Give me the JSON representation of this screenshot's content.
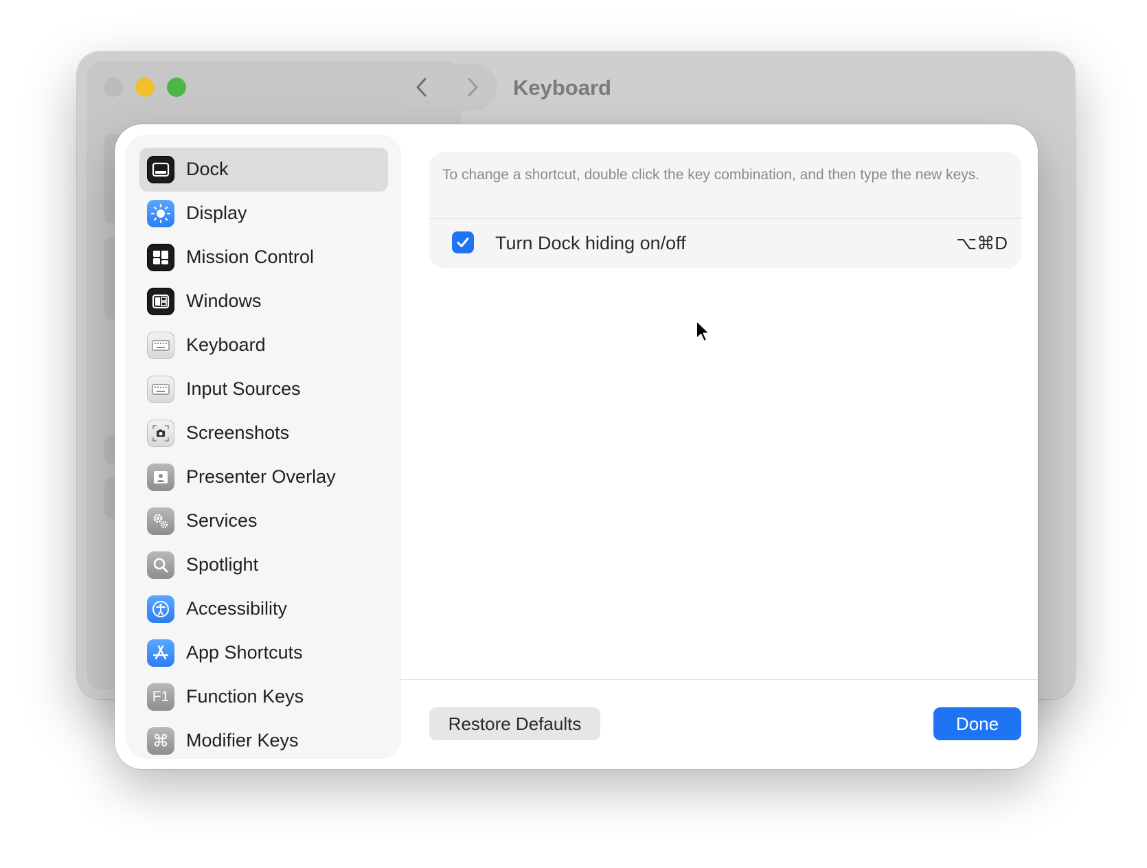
{
  "background_window": {
    "title": "Keyboard",
    "nav": {
      "back_icon": "chevron-left-icon",
      "forward_icon": "chevron-right-icon"
    }
  },
  "sidebar": {
    "items": [
      {
        "label": "Dock",
        "icon": "dock-icon",
        "selected": true
      },
      {
        "label": "Display",
        "icon": "display-brightness-icon"
      },
      {
        "label": "Mission Control",
        "icon": "mission-control-icon"
      },
      {
        "label": "Windows",
        "icon": "windows-icon"
      },
      {
        "label": "Keyboard",
        "icon": "keyboard-icon"
      },
      {
        "label": "Input Sources",
        "icon": "input-sources-keyboard-icon"
      },
      {
        "label": "Screenshots",
        "icon": "camera-icon"
      },
      {
        "label": "Presenter Overlay",
        "icon": "presenter-overlay-icon"
      },
      {
        "label": "Services",
        "icon": "gears-icon"
      },
      {
        "label": "Spotlight",
        "icon": "magnifier-icon"
      },
      {
        "label": "Accessibility",
        "icon": "accessibility-icon"
      },
      {
        "label": "App Shortcuts",
        "icon": "app-store-icon"
      },
      {
        "label": "Function Keys",
        "icon": "f1-key-icon",
        "icon_text": "F1"
      },
      {
        "label": "Modifier Keys",
        "icon": "command-key-icon",
        "icon_text": "⌘"
      }
    ]
  },
  "content": {
    "hint": "To change a shortcut, double click the key combination, and then type the new keys.",
    "shortcuts": [
      {
        "checked": true,
        "label": "Turn Dock hiding on/off",
        "keys": "⌥⌘D"
      }
    ]
  },
  "footer": {
    "restore_label": "Restore Defaults",
    "done_label": "Done"
  },
  "colors": {
    "accent": "#1f74f3",
    "close": "#bcbcbc",
    "minimize": "#f1c02f",
    "maximize": "#4cb748"
  }
}
